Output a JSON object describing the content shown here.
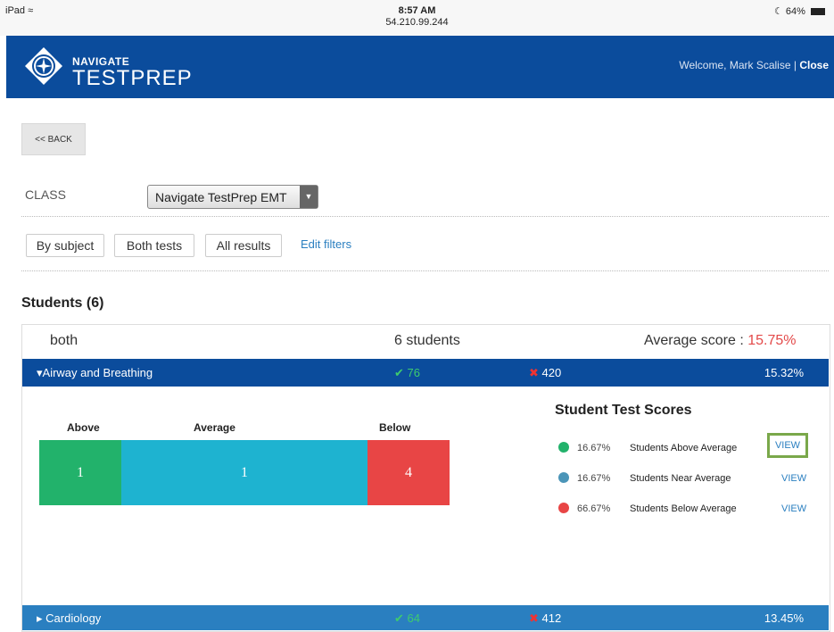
{
  "status_bar": {
    "device": "iPad",
    "time": "8:57 AM",
    "ip": "54.210.99.244",
    "battery": "64%"
  },
  "header": {
    "logo_small": "NAVIGATE",
    "logo_big": "TESTPREP",
    "welcome": "Welcome, Mark Scalise",
    "close": "Close"
  },
  "back_button": "<< BACK",
  "class_selector": {
    "label": "CLASS",
    "value": "Navigate TestPrep EMT"
  },
  "filters": [
    "By subject",
    "Both tests",
    "All results"
  ],
  "edit_filters": "Edit filters",
  "students_title": "Students (6)",
  "summary": {
    "test": "both",
    "students": "6 students",
    "average_label": "Average score : ",
    "average_value": "15.75%"
  },
  "subjects": [
    {
      "name": "Airway and Breathing",
      "correct": "76",
      "incorrect": "420",
      "percent": "15.32%",
      "expanded": true,
      "color": "#0b4c9c"
    },
    {
      "name": "Cardiology",
      "correct": "64",
      "incorrect": "412",
      "percent": "13.45%",
      "expanded": false,
      "color": "#2a7fc0"
    }
  ],
  "distribution": {
    "labels": {
      "above": "Above",
      "average": "Average",
      "below": "Below"
    },
    "counts": {
      "above": "1",
      "average": "1",
      "below": "4"
    },
    "colors": {
      "above": "#22b26b",
      "average": "#1eb3d0",
      "below": "#e84545"
    }
  },
  "test_scores": {
    "title": "Student Test Scores",
    "items": [
      {
        "percent": "16.67%",
        "label": "Students Above Average",
        "action": "VIEW",
        "color": "#22b26b"
      },
      {
        "percent": "16.67%",
        "label": "Students Near Average",
        "action": "VIEW",
        "color": "#4b95b8"
      },
      {
        "percent": "66.67%",
        "label": "Students Below Average",
        "action": "VIEW",
        "color": "#e84545"
      }
    ]
  }
}
